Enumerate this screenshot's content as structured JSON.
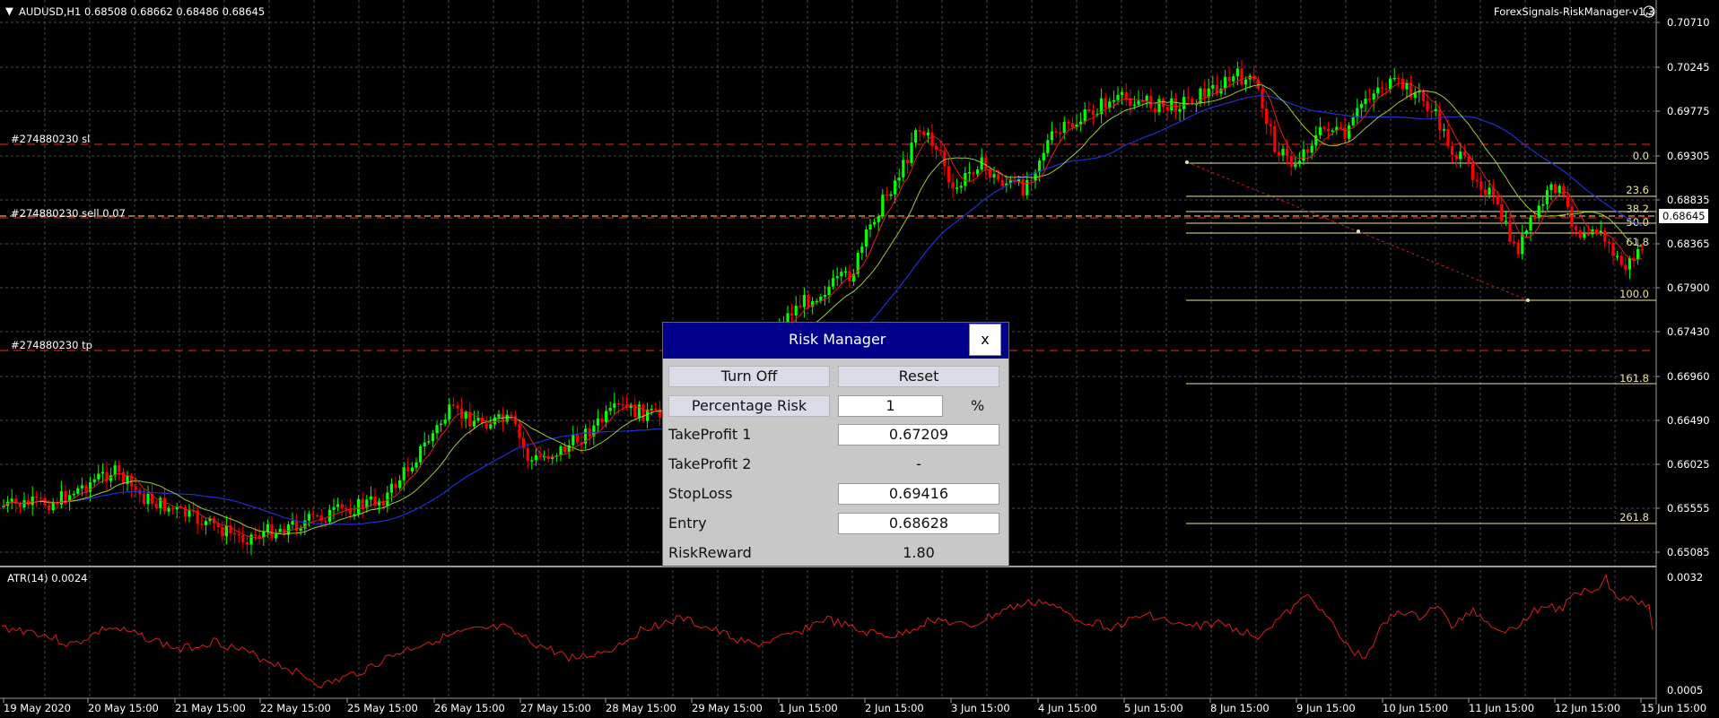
{
  "symbol_header": {
    "marker": "▼",
    "text": "AUDUSD,H1  0.68508 0.68662 0.68486 0.68645"
  },
  "indicator_name": "ForexSignals-RiskManager-v1.3",
  "atr_label": "ATR(14) 0.0024",
  "price_axis": [
    "0.70710",
    "0.70245",
    "0.69775",
    "0.69305",
    "0.68835",
    "0.68365",
    "0.67900",
    "0.67430",
    "0.66960",
    "0.66490",
    "0.66025",
    "0.65555",
    "0.65085"
  ],
  "current_price": "0.68645",
  "atr_axis": [
    "0.0032",
    "0.0005"
  ],
  "time_axis": [
    "19 May 2020",
    "20 May 15:00",
    "21 May 15:00",
    "22 May 15:00",
    "25 May 15:00",
    "26 May 15:00",
    "27 May 15:00",
    "28 May 15:00",
    "29 May 15:00",
    "1 Jun 15:00",
    "2 Jun 15:00",
    "3 Jun 15:00",
    "4 Jun 15:00",
    "5 Jun 15:00",
    "8 Jun 15:00",
    "9 Jun 15:00",
    "10 Jun 15:00",
    "11 Jun 15:00",
    "12 Jun 15:00",
    "15 Jun 15:00"
  ],
  "order_lines": {
    "sl_label": "#274880230 sl",
    "entry_label": "#274880230 sell 0.07",
    "tp_label": "#274880230 tp"
  },
  "fibo_levels": [
    "0.0",
    "23.6",
    "38.2",
    "50.0",
    "61.8",
    "100.0",
    "161.8",
    "261.8"
  ],
  "colors": {
    "background": "#000000",
    "grid": "#4a4a4a",
    "bull_candle": "#00ff00",
    "bear_candle": "#ff0000",
    "order_line": "#c81e1e",
    "fibo": "#e6e6a0",
    "atr_line": "#c81e1e",
    "panel_title": "#00008b"
  },
  "risk_manager": {
    "title": "Risk Manager",
    "close_label": "x",
    "turn_off_label": "Turn Off",
    "reset_label": "Reset",
    "percentage_risk_label": "Percentage Risk",
    "risk_value": "1",
    "risk_unit": "%",
    "tp1_label": "TakeProfit 1",
    "tp1_value": "0.67209",
    "tp2_label": "TakeProfit 2",
    "tp2_value": "-",
    "sl_label": "StopLoss",
    "sl_value": "0.69416",
    "entry_label": "Entry",
    "entry_value": "0.68628",
    "rr_label": "RiskReward",
    "rr_value": "1.80"
  }
}
